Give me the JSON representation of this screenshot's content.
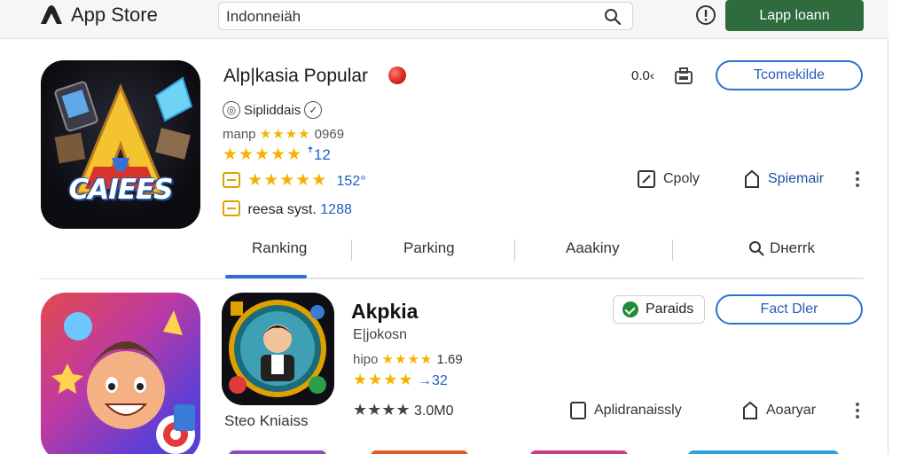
{
  "header": {
    "brand": "App Store",
    "search_value": "Indonneiäh",
    "login_label": "Lapp loann"
  },
  "app1": {
    "title": "Alp|kasia Popular",
    "developer": "Sipliddais",
    "icon_caption": "CAIEES",
    "rating_prefix": "manp",
    "rating_stars": "★★★★",
    "rating_value": "0969",
    "stars_row": "★★★★★",
    "stars_value": "12",
    "badge_stars": "★★★★★",
    "badge_value": "152°",
    "meta_label": "reesa syst.",
    "meta_value": "1288",
    "price": "0.0‹",
    "action_button": "Tcomekilde",
    "action_copy": "Cpoly",
    "action_share": "Spiemair"
  },
  "tabs": [
    "Ranking",
    "Parking",
    "Aaakiny",
    "Dнerrk"
  ],
  "app2": {
    "title": "Akpkia",
    "developer": "E|jokosn",
    "rating_prefix": "hipo",
    "rating_stars": "★★★★",
    "rating_value": "1.69",
    "stars_row": "★★★★",
    "stars_value": "32",
    "stars_row2": "★★★★",
    "stars_value2": "3.0M0",
    "chip_label": "Paraids",
    "action_button": "Fact Dler",
    "action_analytics": "Aplidranaissly",
    "action_share": "Aoaryar",
    "caption": "Steo Kniaiss"
  },
  "colors": {
    "primary_green": "#2e6b3d",
    "accent_blue": "#2f6fd1",
    "star_yellow": "#f5b301"
  }
}
